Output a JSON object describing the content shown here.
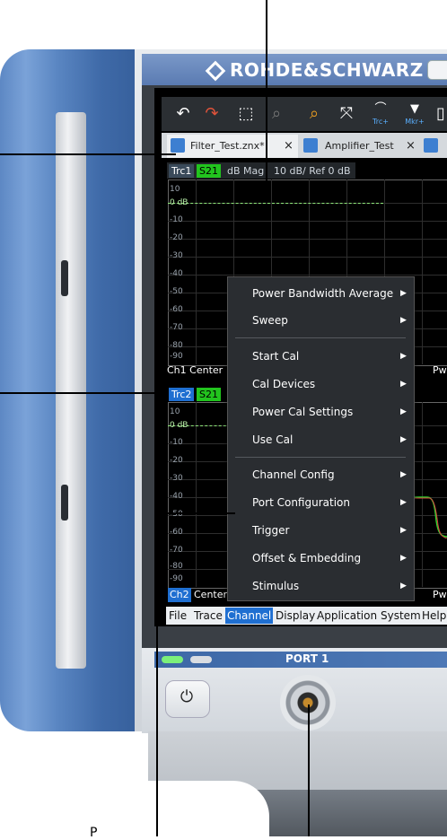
{
  "brand": {
    "logo_text": "ROHDE&SCHWARZ"
  },
  "toolbar": {
    "icons": [
      "undo-icon",
      "redo-icon",
      "zoom-box-icon",
      "zoom-reset-icon",
      "marker-search-icon",
      "fullscreen-icon",
      "add-trace-icon",
      "add-marker-icon",
      "delete-icon"
    ],
    "trc_plus": "Trc+",
    "mkr_plus": "Mkr+"
  },
  "tabs": [
    {
      "label": "Filter_Test.znx",
      "dirty": "*",
      "close": "×"
    },
    {
      "label": "Amplifier_Test",
      "close": "×"
    }
  ],
  "trace1": {
    "name": "Trc1",
    "param": "S21",
    "format": "dB Mag",
    "scale": "10 dB/ Ref 0 dB"
  },
  "trace2": {
    "name": "Trc2",
    "param": "S21"
  },
  "diagram1": {
    "y_labels": [
      "10",
      "0 dB",
      "-10",
      "-20",
      "-30",
      "-40",
      "-50",
      "-60",
      "-70",
      "-80",
      "-90"
    ],
    "footer_left": "Ch1  Center",
    "footer_right": "Pwr"
  },
  "diagram2": {
    "y_labels": [
      "10",
      "0 dB",
      "-10",
      "-20",
      "-30",
      "-40",
      "-50",
      "-60",
      "-70",
      "-80",
      "-90"
    ],
    "footer_left": "Center",
    "channel_tag": "Ch2",
    "footer_right": "Pwr"
  },
  "context_menu": {
    "items": [
      {
        "label": "Power Bandwidth Average"
      },
      {
        "label": "Sweep"
      },
      {
        "label": "Start Cal"
      },
      {
        "label": "Cal Devices"
      },
      {
        "label": "Power Cal Settings"
      },
      {
        "label": "Use Cal"
      },
      {
        "label": "Channel Config"
      },
      {
        "label": "Port Configuration"
      },
      {
        "label": "Trigger"
      },
      {
        "label": "Offset & Embedding"
      },
      {
        "label": "Stimulus"
      }
    ],
    "arrow": "▶"
  },
  "menubar": {
    "items": [
      "File",
      "Trace",
      "Channel",
      "Display",
      "Application",
      "System",
      "Help"
    ],
    "active": "Channel"
  },
  "front_panel": {
    "port_label": "PORT 1",
    "power_symbol": "⏻"
  },
  "bottom_label": "P",
  "colors": {
    "accent_blue": "#1f6fd1",
    "trace_green": "#20d020",
    "param_green": "#22c41e",
    "panel_blue": "#4a74b3"
  }
}
